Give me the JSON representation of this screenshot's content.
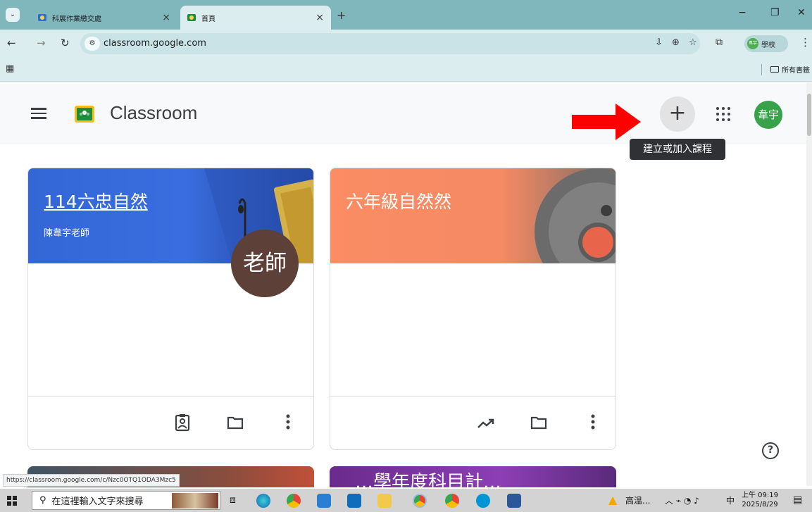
{
  "browser": {
    "tabs": [
      {
        "title": "科展作業繳交處",
        "close": "×"
      },
      {
        "title": "首頁",
        "close": "×"
      }
    ],
    "new_tab": "+",
    "window_controls": {
      "minimize": "−",
      "restore": "❐",
      "close": "✕"
    },
    "url": "classroom.google.com",
    "profile_label": "學校",
    "profile_initials": "韋宇",
    "bookmarks_folder": "所有書籤",
    "status_url": "https://classroom.google.com/c/Nzc0OTQ1ODA3Mzc5"
  },
  "classroom": {
    "title": "Classroom",
    "plus_label": "+",
    "tooltip": "建立或加入課程",
    "avatar_text": "韋宇",
    "help_label": "?"
  },
  "cards": [
    {
      "title": "114六忠自然",
      "subtitle": "陳韋宇老師",
      "badge": "老師",
      "color": "#3367d6"
    },
    {
      "title": "六年級自然然",
      "subtitle": "",
      "color": "#fb8c64"
    }
  ],
  "peek_text": "…學年度科目計…",
  "taskbar": {
    "search_placeholder": "在這裡輸入文字來搜尋",
    "weather": "高溫...",
    "ime": "中",
    "time": "上午 09:19",
    "date": "2025/8/29"
  },
  "icons": {
    "accent_red": "#ff0000",
    "classroom_green": "#1e8e3e"
  }
}
